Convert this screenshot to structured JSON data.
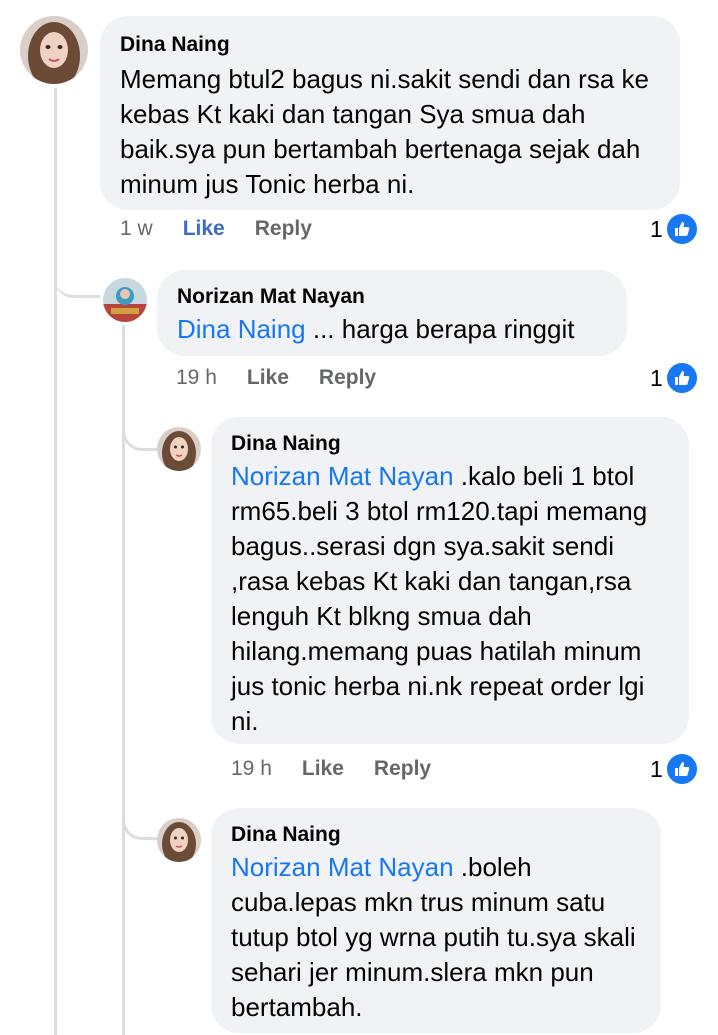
{
  "comments": [
    {
      "author": "Dina Naing",
      "text": "Memang btul2 bagus ni.sakit sendi dan rsa ke kebas Kt kaki dan tangan Sya smua dah baik.sya pun bertambah bertenaga sejak dah minum jus Tonic herba ni.",
      "time": "1 w",
      "like_label": "Like",
      "reply_label": "Reply",
      "reaction_count": "1",
      "reaction_icon": "like-icon"
    },
    {
      "author": "Norizan Mat Nayan",
      "mention": "Dina Naing",
      "text": " ... harga berapa ringgit",
      "time": "19 h",
      "like_label": "Like",
      "reply_label": "Reply",
      "reaction_count": "1",
      "reaction_icon": "like-icon"
    },
    {
      "author": "Dina Naing",
      "mention": "Norizan Mat Nayan",
      "text": " .kalo beli 1 btol rm65.beli 3 btol rm120.tapi memang bagus..serasi dgn sya.sakit sendi ,rasa kebas Kt kaki dan tangan,rsa lenguh Kt blkng smua dah hilang.memang puas hatilah minum jus tonic herba ni.nk repeat order lgi ni.",
      "time": "19 h",
      "like_label": "Like",
      "reply_label": "Reply",
      "reaction_count": "1",
      "reaction_icon": "like-icon"
    },
    {
      "author": "Dina Naing",
      "mention": "Norizan Mat Nayan",
      "text": " .boleh cuba.lepas mkn trus minum satu tutup btol yg wrna putih tu.sya skali sehari jer minum.slera mkn pun bertambah."
    }
  ],
  "colors": {
    "bubble": "#f0f2f5",
    "mention": "#1877f2",
    "like_link": "#3c6cc4",
    "meta": "#65676b",
    "thread_line": "#dadde1"
  }
}
